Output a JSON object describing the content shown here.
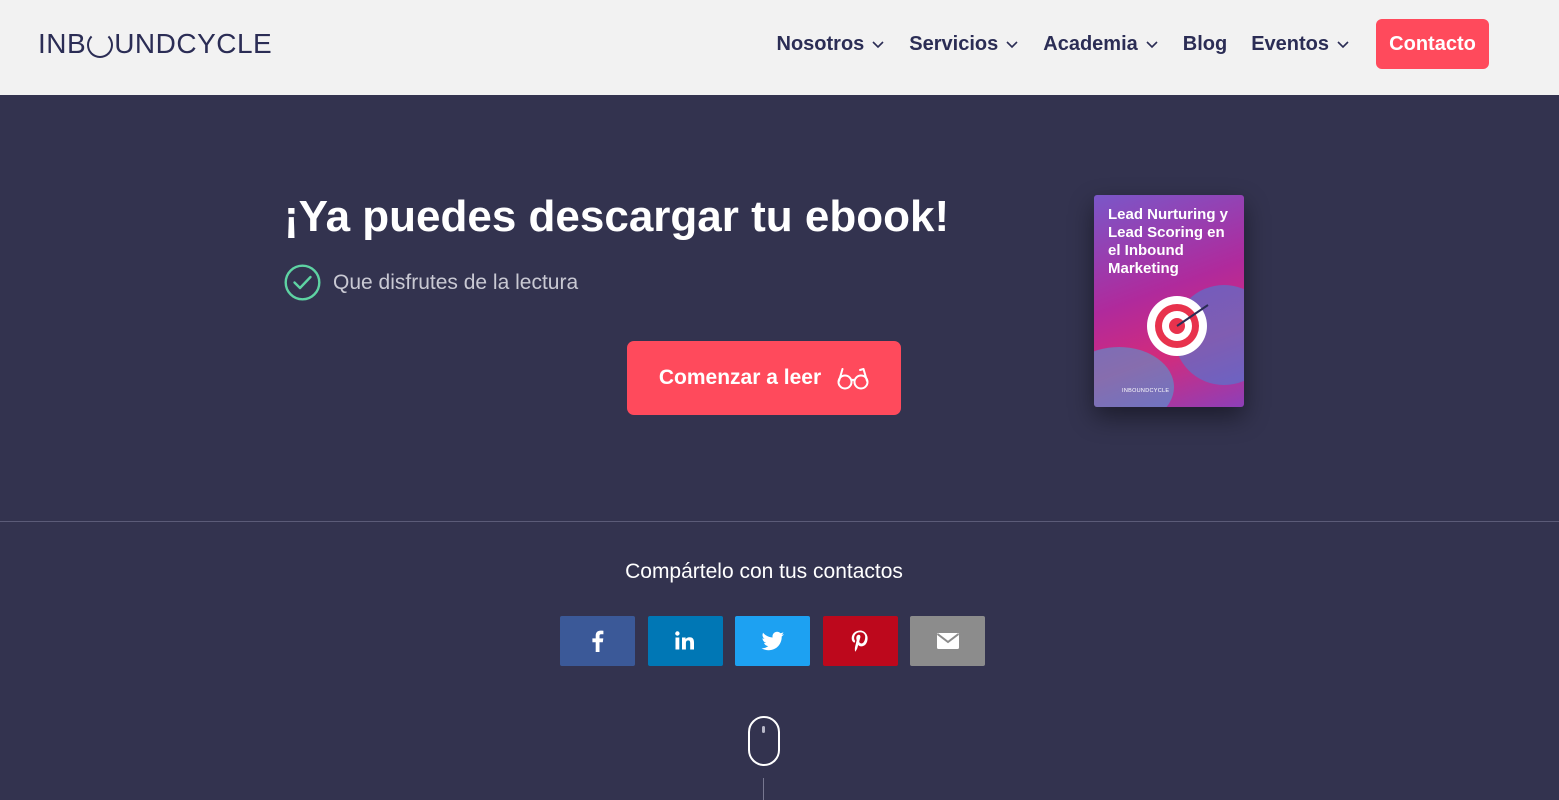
{
  "header": {
    "logo_parts": {
      "before": "INB",
      "after": "UNDCYCLE"
    },
    "logo_text": "INBOUNDCYCLE",
    "nav": [
      {
        "label": "Nosotros",
        "has_dropdown": true
      },
      {
        "label": "Servicios",
        "has_dropdown": true
      },
      {
        "label": "Academia",
        "has_dropdown": true
      },
      {
        "label": "Blog",
        "has_dropdown": false
      },
      {
        "label": "Eventos",
        "has_dropdown": true
      }
    ],
    "contact_label": "Contacto"
  },
  "hero": {
    "title": "¡Ya puedes descargar tu ebook!",
    "subtitle": "Que disfrutes de la lectura",
    "read_button": "Comenzar a leer"
  },
  "ebook": {
    "title": "Lead Nurturing y Lead Scoring en el Inbound Marketing",
    "brand": "INBOUNDCYCLE"
  },
  "share": {
    "label": "Compártelo con tus contactos",
    "buttons": [
      {
        "name": "facebook",
        "icon": "facebook-icon",
        "color": "#3b5998"
      },
      {
        "name": "linkedin",
        "icon": "linkedin-icon",
        "color": "#0077b5"
      },
      {
        "name": "twitter",
        "icon": "twitter-icon",
        "color": "#1da1f2"
      },
      {
        "name": "pinterest",
        "icon": "pinterest-icon",
        "color": "#bd081c"
      },
      {
        "name": "email",
        "icon": "envelope-icon",
        "color": "#8c8c8c"
      }
    ]
  },
  "colors": {
    "background": "#33334f",
    "header_bg": "#f2f2f2",
    "accent": "#ff4a5c",
    "nav_text": "#2b2d55",
    "check_green": "#5ed3a3"
  }
}
